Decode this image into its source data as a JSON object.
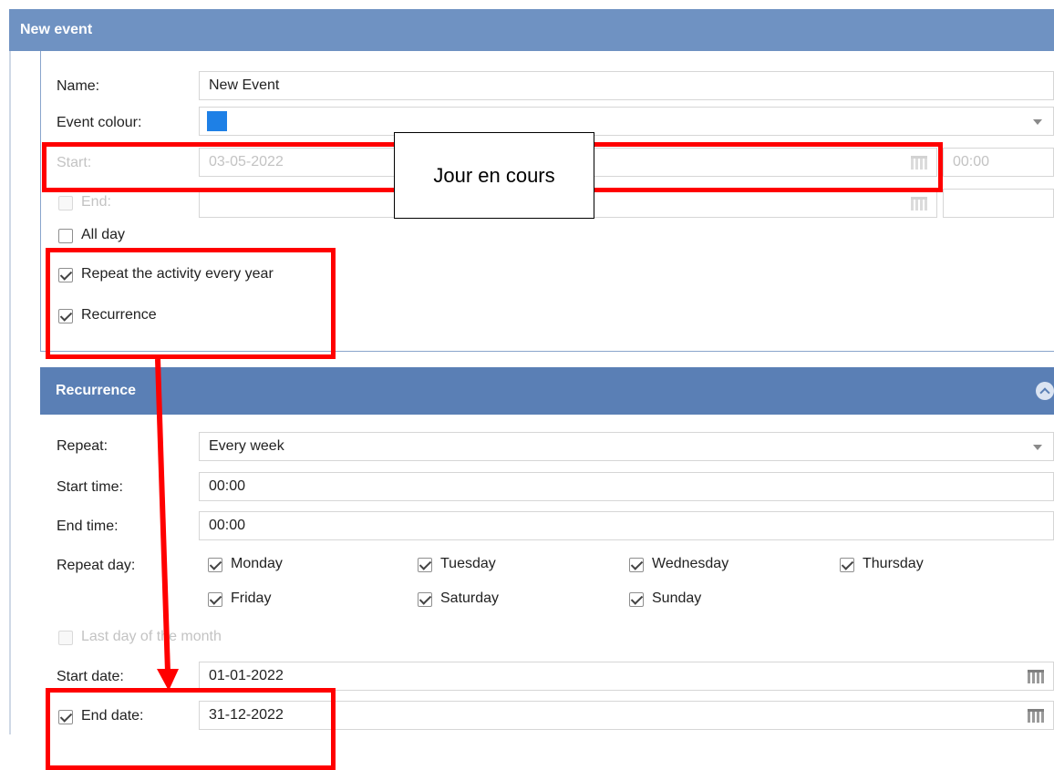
{
  "header": {
    "title": "New event"
  },
  "form": {
    "name_label": "Name:",
    "name_value": "New Event",
    "colour_label": "Event colour:",
    "colour_value": "#1e80e6",
    "start_label": "Start:",
    "start_date": "03-05-2022",
    "start_time": "00:00",
    "end_label": "End:",
    "end_date": "",
    "end_time": "",
    "all_day_label": "All day",
    "all_day_checked": false,
    "repeat_year_label": "Repeat the activity every year",
    "repeat_year_checked": true,
    "recurrence_label": "Recurrence",
    "recurrence_checked": true
  },
  "recurrence": {
    "title": "Recurrence",
    "repeat_label": "Repeat:",
    "repeat_value": "Every week",
    "start_time_label": "Start time:",
    "start_time_value": "00:00",
    "end_time_label": "End time:",
    "end_time_value": "00:00",
    "repeat_day_label": "Repeat day:",
    "days": [
      {
        "label": "Monday",
        "checked": true
      },
      {
        "label": "Tuesday",
        "checked": true
      },
      {
        "label": "Wednesday",
        "checked": true
      },
      {
        "label": "Thursday",
        "checked": true
      },
      {
        "label": "Friday",
        "checked": true
      },
      {
        "label": "Saturday",
        "checked": true
      },
      {
        "label": "Sunday",
        "checked": true
      }
    ],
    "last_day_label": "Last day of the month",
    "start_date_label": "Start date:",
    "start_date_value": "01-01-2022",
    "end_date_label": "End date:",
    "end_date_value": "31-12-2022",
    "end_date_checked": true
  },
  "annotation": {
    "callout_text": "Jour en cours",
    "color": "#ff0000"
  },
  "icons": {
    "calendar": "calendar-icon",
    "dropdown": "chevron-down-icon",
    "collapse": "chevron-up-circle-icon"
  }
}
